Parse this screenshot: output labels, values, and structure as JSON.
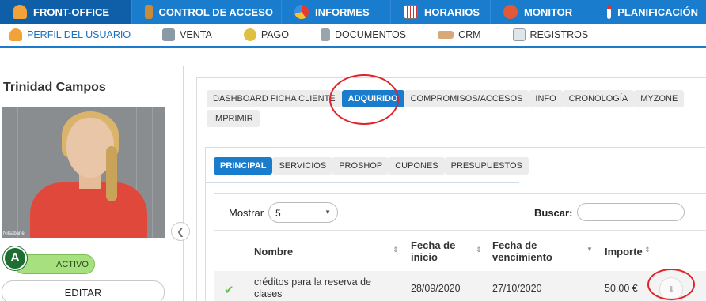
{
  "topnav": [
    {
      "label": "FRONT-OFFICE",
      "icon": "user-icon",
      "active": true
    },
    {
      "label": "CONTROL DE ACCESO",
      "icon": "door-icon"
    },
    {
      "label": "INFORMES",
      "icon": "pie-chart-icon"
    },
    {
      "label": "HORARIOS",
      "icon": "calendar-grid-icon"
    },
    {
      "label": "MONITOR",
      "icon": "people-icon"
    },
    {
      "label": "PLANIFICACIÓN",
      "icon": "calendar-icon"
    }
  ],
  "subnav": [
    {
      "label": "PERFIL DEL USUARIO",
      "icon": "user-icon",
      "active": true
    },
    {
      "label": "VENTA",
      "icon": "cash-register-icon"
    },
    {
      "label": "PAGO",
      "icon": "coin-icon"
    },
    {
      "label": "DOCUMENTOS",
      "icon": "document-icon"
    },
    {
      "label": "CRM",
      "icon": "handshake-icon"
    },
    {
      "label": "REGISTROS",
      "icon": "notepad-icon"
    }
  ],
  "client": {
    "name": "Trinidad Campos",
    "photo_caption": "Nilsabane",
    "status_letter": "A",
    "status": "ACTIVO",
    "edit_label": "EDITAR"
  },
  "tabs_main": [
    "DASHBOARD FICHA CLIENTE",
    "ADQUIRIDO",
    "COMPROMISOS/ACCESOS",
    "INFO",
    "CRONOLOGÍA",
    "MYZONE"
  ],
  "tabs_main_row2": [
    "IMPRIMIR"
  ],
  "tabs_sub": [
    "PRINCIPAL",
    "SERVICIOS",
    "PROSHOP",
    "CUPONES",
    "PRESUPUESTOS"
  ],
  "table": {
    "show_label": "Mostrar",
    "show_value": "5",
    "search_label": "Buscar:",
    "search_value": "",
    "columns": [
      "Nombre",
      "Fecha de inicio",
      "Fecha de vencimiento",
      "Importe"
    ],
    "rows": [
      {
        "nombre": "créditos para la reserva de clases",
        "inicio": "28/09/2020",
        "vencimiento": "27/10/2020",
        "importe": "50,00 €"
      }
    ]
  },
  "colors": {
    "primary": "#1a7ccd",
    "active_dark": "#0f5fa8",
    "status_green": "#a7e07e",
    "annotation_red": "#e2222a"
  }
}
